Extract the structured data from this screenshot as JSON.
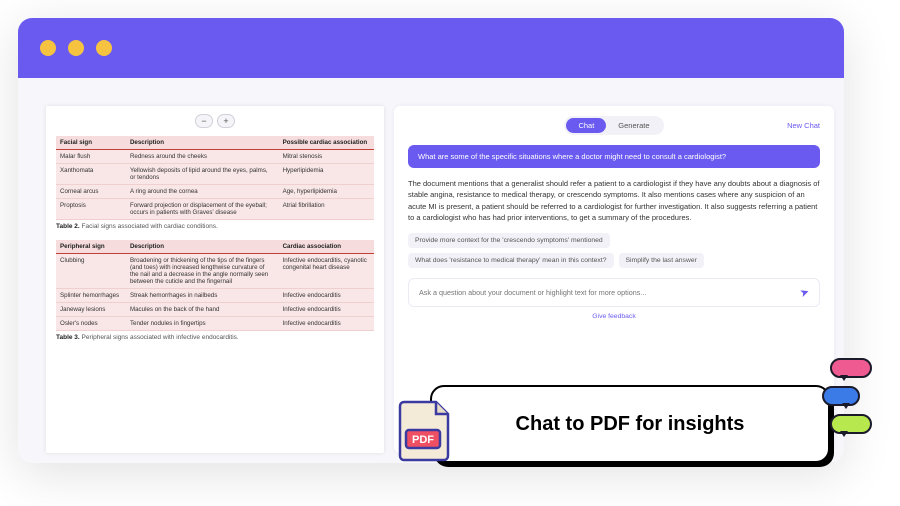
{
  "tabs": {
    "chat": "Chat",
    "generate": "Generate"
  },
  "new_chat": "New Chat",
  "question": "What are some of the specific situations where a doctor might need to consult a cardiologist?",
  "answer": "The document mentions that a generalist should refer a patient to a cardiologist if they have any doubts about a diagnosis of stable angina, resistance to medical therapy, or crescendo symptoms. It also mentions cases where any suspicion of an acute MI is present, a patient should be referred to a cardiologist for further investigation. It also suggests referring a patient to a cardiologist who has had prior interventions, to get a summary of the procedures.",
  "chips": {
    "c1": "Provide more context for the 'crescendo symptoms' mentioned",
    "c2": "What does 'resistance to medical therapy' mean in this context?",
    "c3": "Simplify the last answer"
  },
  "ask_placeholder": "Ask a question about your document or highlight text for more options...",
  "feedback": "Give feedback",
  "zoom": {
    "out": "−",
    "in": "+"
  },
  "table2": {
    "h1": "Facial sign",
    "h2": "Description",
    "h3": "Possible cardiac association",
    "r1c1": "Malar flush",
    "r1c2": "Redness around the cheeks",
    "r1c3": "Mitral stenosis",
    "r2c1": "Xanthomata",
    "r2c2": "Yellowish deposits of lipid around the eyes, palms, or tendons",
    "r2c3": "Hyperlipidemia",
    "r3c1": "Corneal arcus",
    "r3c2": "A ring around the cornea",
    "r3c3": "Age, hyperlipidemia",
    "r4c1": "Proptosis",
    "r4c2": "Forward projection or displacement of the eyeball; occurs in patients with Graves' disease",
    "r4c3": "Atrial fibrillation",
    "caption_b": "Table 2.",
    "caption": " Facial signs associated with cardiac conditions."
  },
  "table3": {
    "h1": "Peripheral sign",
    "h2": "Description",
    "h3": "Cardiac association",
    "r1c1": "Clubbing",
    "r1c2": "Broadening or thickening of the tips of the fingers (and toes) with increased lengthwise curvature of the nail and a decrease in the angle normally seen between the cuticle and the fingernail",
    "r1c3": "Infective endocarditis, cyanotic congenital heart disease",
    "r2c1": "Splinter hemorrhages",
    "r2c2": "Streak hemorrhages in nailbeds",
    "r2c3": "Infective endocarditis",
    "r3c1": "Janeway lesions",
    "r3c2": "Macules on the back of the hand",
    "r3c3": "Infective endocarditis",
    "r4c1": "Osler's nodes",
    "r4c2": "Tender nodules in fingertips",
    "r4c3": "Infective endocarditis",
    "caption_b": "Table 3.",
    "caption": " Peripheral signs associated with infective endocarditis."
  },
  "callout": "Chat to PDF for insights",
  "pdf_label": "PDF"
}
